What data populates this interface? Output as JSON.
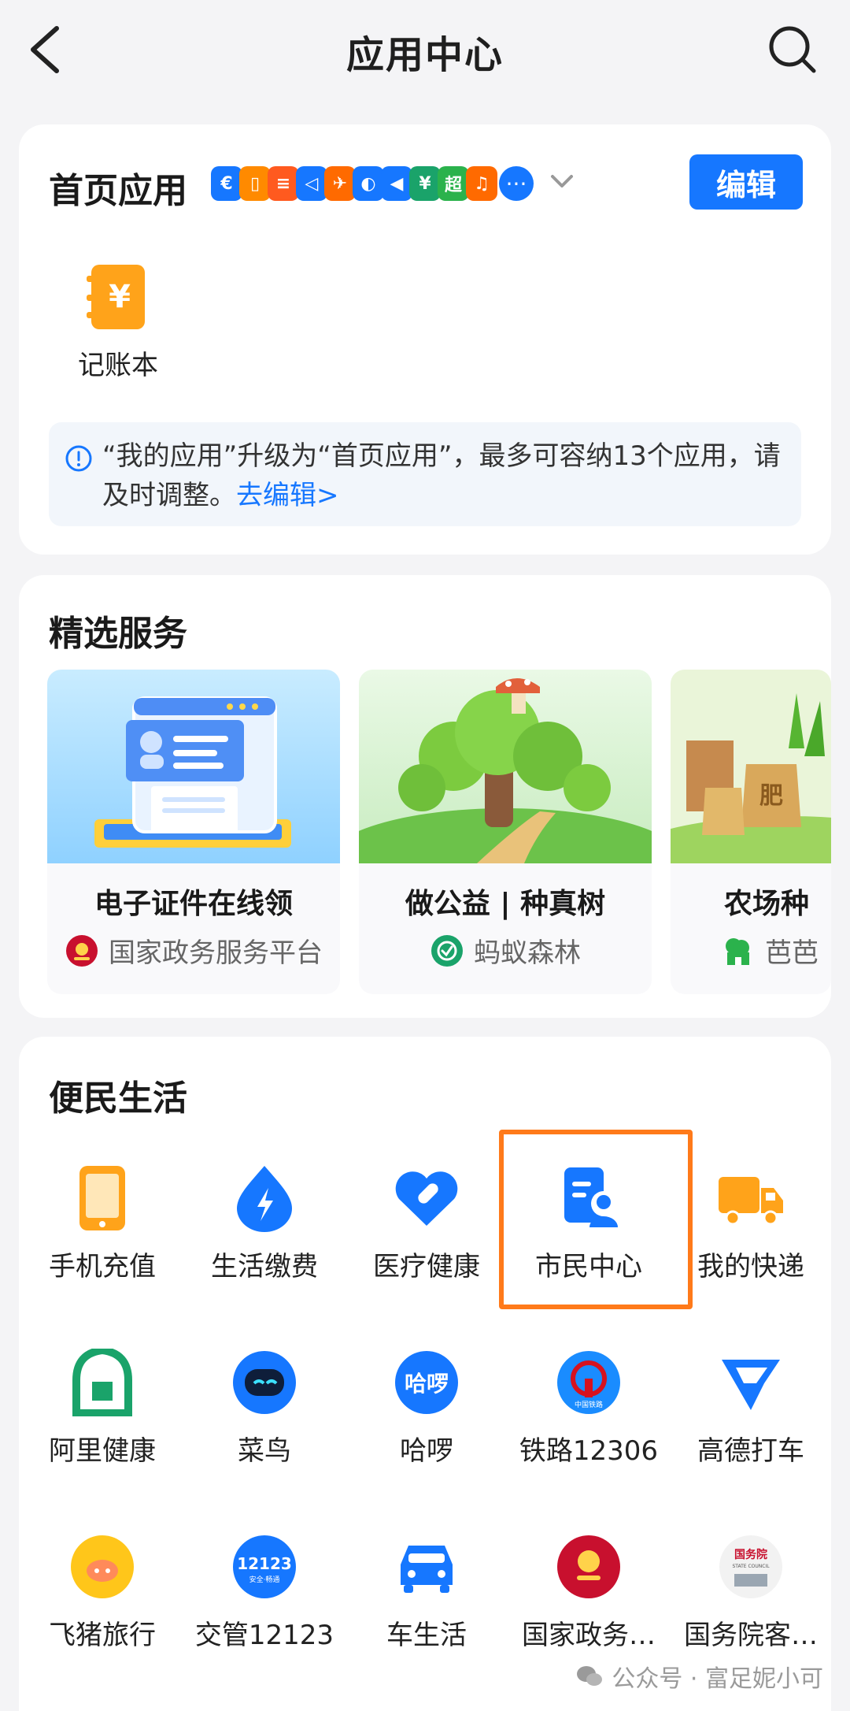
{
  "header": {
    "title": "应用中心"
  },
  "home_apps": {
    "title": "首页应用",
    "edit_label": "编辑",
    "more_label": "···",
    "fav_icons": [
      {
        "color": "#1677ff",
        "glyph": "€"
      },
      {
        "color": "#ff8a00",
        "glyph": "▯"
      },
      {
        "color": "#ff5a1f",
        "glyph": "≡"
      },
      {
        "color": "#1677ff",
        "glyph": "◁"
      },
      {
        "color": "#ff6a00",
        "glyph": "✈"
      },
      {
        "color": "#1677ff",
        "glyph": "◐"
      },
      {
        "color": "#1677ff",
        "glyph": "◀"
      },
      {
        "color": "#1aa36a",
        "glyph": "¥"
      },
      {
        "color": "#2bb24c",
        "glyph": "超"
      },
      {
        "color": "#ff6a00",
        "glyph": "♫"
      }
    ],
    "apps": [
      {
        "label": "记账本",
        "color": "#ffa31a",
        "glyph": "¥"
      }
    ],
    "notice": {
      "text": "“我的应用”升级为“首页应用”，最多可容纳13个应用，请及时调整。",
      "link": "去编辑>"
    }
  },
  "featured": {
    "title": "精选服务",
    "cards": [
      {
        "title": "电子证件在线领",
        "provider": "国家政务服务平台",
        "provider_color": "#c8102e"
      },
      {
        "title": "做公益 | 种真树",
        "provider": "蚂蚁森林",
        "provider_color": "#1aa36a"
      },
      {
        "title": "农场种",
        "provider": "芭芭",
        "provider_color": "#2bb24c"
      }
    ]
  },
  "life": {
    "title": "便民生活",
    "apps": [
      {
        "label": "手机充值",
        "icon": "phone-icon",
        "color": "#ffa31a"
      },
      {
        "label": "生活缴费",
        "icon": "bolt-icon",
        "color": "#1677ff"
      },
      {
        "label": "医疗健康",
        "icon": "heart-icon",
        "color": "#1677ff"
      },
      {
        "label": "市民中心",
        "icon": "citizen-icon",
        "color": "#1677ff"
      },
      {
        "label": "我的快递",
        "icon": "truck-icon",
        "color": "#ffa31a"
      },
      {
        "label": "阿里健康",
        "icon": "alihealth-icon",
        "color": "#1aa36a"
      },
      {
        "label": "菜鸟",
        "icon": "cainiao-icon",
        "color": "#1677ff"
      },
      {
        "label": "哈啰",
        "icon": "hello-icon",
        "color": "#1677ff"
      },
      {
        "label": "铁路12306",
        "icon": "railway-icon",
        "color": "#1677ff"
      },
      {
        "label": "高德打车",
        "icon": "amap-icon",
        "color": "#1677ff"
      },
      {
        "label": "飞猪旅行",
        "icon": "fliggy-icon",
        "color": "#ffb800"
      },
      {
        "label": "交管12123",
        "icon": "traffic-icon",
        "color": "#1677ff"
      },
      {
        "label": "车生活",
        "icon": "car-icon",
        "color": "#1677ff"
      },
      {
        "label": "国家政务…",
        "icon": "gov-icon",
        "color": "#c8102e"
      },
      {
        "label": "国务院客…",
        "icon": "statecouncil-icon",
        "color": "#555555"
      }
    ],
    "icon_texts": {
      "hello": "哈啰",
      "railway": "中国铁路",
      "traffic": "12123",
      "traffic_sub": "安全·畅通",
      "statecouncil": "国务院",
      "statecouncil_sub": "STATE COUNCIL"
    }
  },
  "watermark": {
    "text": "公众号 · 富足妮小可"
  }
}
